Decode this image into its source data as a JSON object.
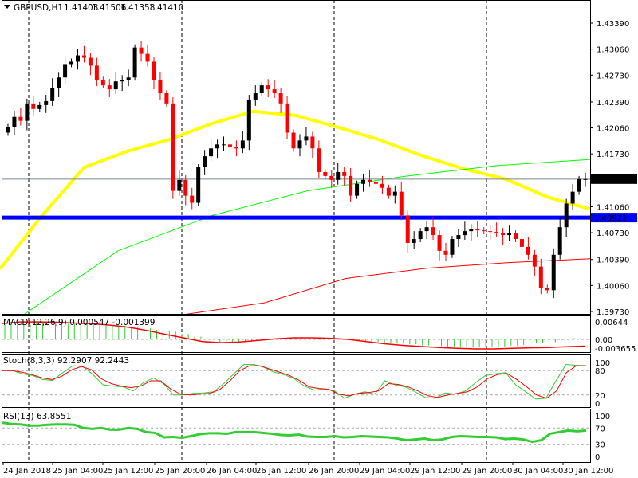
{
  "header": {
    "symbol": "GBPUSD,H1",
    "open": "1.41403",
    "high": "1.41506",
    "low": "1.41358",
    "close": "1.41410"
  },
  "colors": {
    "bull": "#000000",
    "bear": "#ff0000",
    "ma_fast": "#ffff00",
    "ma_mid": "#00ff00",
    "ma_slow": "#ff0000",
    "level": "#0000ff",
    "osc_k": "#32cd32",
    "osc_d": "#ff0000"
  },
  "chart_data": [
    {
      "type": "candlestick",
      "title": "GBPUSD,H1",
      "ylim": [
        1.3973,
        1.4339
      ],
      "y_ticks": [
        "1.43390",
        "1.43060",
        "1.42730",
        "1.42390",
        "1.42060",
        "1.41730",
        "1.41410",
        "1.41060",
        "1.40922",
        "1.40730",
        "1.40390",
        "1.40060",
        "1.39730"
      ],
      "current_price_label": "1.41410",
      "level_line": {
        "value": 1.40922,
        "label": "1.40922"
      },
      "x_tick_labels": [
        "24 Jan 2018",
        "25 Jan 04:00",
        "25 Jan 12:00",
        "25 Jan 20:00",
        "26 Jan 04:00",
        "26 Jan 12:00",
        "26 Jan 20:00",
        "29 Jan 04:00",
        "29 Jan 12:00",
        "29 Jan 20:00",
        "30 Jan 04:00",
        "30 Jan 12:00"
      ],
      "closes": [
        1.4207,
        1.422,
        1.4215,
        1.4237,
        1.423,
        1.4235,
        1.424,
        1.4257,
        1.427,
        1.4287,
        1.429,
        1.4298,
        1.4295,
        1.4285,
        1.4267,
        1.426,
        1.4255,
        1.4265,
        1.4267,
        1.427,
        1.4308,
        1.43,
        1.429,
        1.4267,
        1.425,
        1.4237,
        1.4126,
        1.414,
        1.412,
        1.4111,
        1.4156,
        1.417,
        1.418,
        1.4185,
        1.4185,
        1.4182,
        1.418,
        1.419,
        1.4242,
        1.425,
        1.426,
        1.4255,
        1.425,
        1.4237,
        1.42,
        1.418,
        1.419,
        1.4195,
        1.418,
        1.415,
        1.4145,
        1.414,
        1.415,
        1.4145,
        1.412,
        1.4135,
        1.414,
        1.4137,
        1.4135,
        1.413,
        1.412,
        1.4125,
        1.4095,
        1.406,
        1.4065,
        1.4075,
        1.408,
        1.407,
        1.405,
        1.4045,
        1.4065,
        1.407,
        1.4075,
        1.4078,
        1.4076,
        1.4075,
        1.4074,
        1.4073,
        1.407,
        1.4072,
        1.4065,
        1.4055,
        1.4045,
        1.403,
        1.4003,
        1.4,
        1.4045,
        1.408,
        1.411,
        1.4125,
        1.4141,
        1.4141
      ],
      "first_open": 1.42,
      "moving_averages": [
        {
          "name": "yellow MA",
          "start": 0.0,
          "values": [
            1.4027,
            1.4095,
            1.4156,
            1.4176,
            1.4191,
            1.4211,
            1.4227,
            1.4222,
            1.4207,
            1.4191,
            1.4171,
            1.4154,
            1.4141,
            1.4118,
            1.4103
          ]
        },
        {
          "name": "green MA",
          "start": 0.04,
          "values": [
            1.3969,
            1.405,
            1.4095,
            1.4126,
            1.4144,
            1.4158,
            1.4166
          ]
        },
        {
          "name": "red MA",
          "start": 0.31,
          "values": [
            1.3969,
            1.3984,
            1.4015,
            1.4028,
            1.4035,
            1.404
          ]
        }
      ]
    },
    {
      "type": "bar",
      "title": "MACD(12,26,9) 0.000547 -0.001399",
      "ylim": [
        -0.003655,
        0.00644
      ],
      "y_ticks": [
        "0.00644",
        "0.00",
        "-0.003655"
      ],
      "histogram": [
        0.0055,
        0.0056,
        0.0057,
        0.0058,
        0.0058,
        0.0057,
        0.0056,
        0.0055,
        0.0053,
        0.005,
        0.0045,
        0.004,
        0.0035,
        0.003,
        0.002,
        0.001,
        0.0002,
        -0.001,
        -0.0012,
        -0.0008,
        -0.0004,
        -0.0002,
        0.0002,
        0.0005,
        0.0007,
        0.0006,
        0.0004,
        0.0001,
        -0.0006,
        -0.001,
        -0.0014,
        -0.0016,
        -0.0018,
        -0.0022,
        -0.0025,
        -0.0028,
        -0.003,
        -0.003,
        -0.0028,
        -0.0026,
        -0.0024,
        -0.002,
        -0.0015,
        -0.001,
        -0.0002,
        0.0005
      ],
      "signal": [
        0.0058,
        0.0064,
        0.0064,
        0.0063,
        0.006,
        0.0057,
        0.0052,
        0.0044,
        0.0032,
        0.0018,
        0.0005,
        -0.0008,
        -0.0012,
        -0.001,
        -0.0004,
        0.0002,
        0.0006,
        0.0006,
        0.0004,
        0.0,
        -0.0008,
        -0.0016,
        -0.0022,
        -0.0026,
        -0.003,
        -0.0033,
        -0.0035,
        -0.0035,
        -0.0033,
        -0.0031,
        -0.003,
        -0.0027,
        -0.0025
      ]
    },
    {
      "type": "line",
      "title": "Stoch(8,3,3) 92.2907 92.2443",
      "ylim": [
        0,
        100
      ],
      "y_ticks": [
        "100",
        "80",
        "20",
        "0"
      ],
      "series": [
        {
          "name": "%K",
          "values": [
            80,
            80,
            72,
            68,
            58,
            56,
            75,
            92,
            90,
            70,
            45,
            42,
            40,
            30,
            50,
            62,
            48,
            20,
            20,
            24,
            25,
            28,
            48,
            72,
            95,
            95,
            88,
            76,
            70,
            60,
            42,
            32,
            35,
            30,
            12,
            22,
            28,
            22,
            55,
            45,
            40,
            28,
            14,
            12,
            25,
            22,
            30,
            50,
            68,
            72,
            75,
            45,
            28,
            10,
            12,
            55,
            95,
            93,
            92
          ]
        },
        {
          "name": "%D",
          "values": [
            80,
            80,
            76,
            70,
            62,
            58,
            66,
            82,
            90,
            82,
            60,
            48,
            42,
            38,
            42,
            55,
            55,
            35,
            22,
            20,
            22,
            24,
            34,
            55,
            80,
            92,
            92,
            84,
            76,
            68,
            56,
            40,
            36,
            34,
            22,
            18,
            24,
            26,
            30,
            48,
            46,
            40,
            30,
            18,
            14,
            20,
            24,
            28,
            40,
            60,
            70,
            73,
            58,
            40,
            20,
            12,
            30,
            75,
            92,
            92
          ]
        }
      ]
    },
    {
      "type": "line",
      "title": "RSI(13) 63.8551",
      "ylim": [
        0,
        100
      ],
      "y_ticks": [
        "100",
        "70",
        "30",
        "0"
      ],
      "series": [
        {
          "name": "RSI",
          "values": [
            83,
            80,
            79,
            76,
            76,
            78,
            79,
            79,
            78,
            70,
            68,
            70,
            66,
            66,
            70,
            68,
            60,
            58,
            47,
            48,
            46,
            50,
            55,
            57,
            57,
            56,
            60,
            60,
            60,
            58,
            56,
            53,
            52,
            54,
            49,
            48,
            48,
            50,
            47,
            48,
            50,
            49,
            48,
            47,
            44,
            40,
            42,
            44,
            40,
            42,
            48,
            50,
            49,
            48,
            48,
            47,
            43,
            44,
            42,
            36,
            40,
            56,
            60,
            64,
            62,
            64
          ]
        }
      ]
    }
  ]
}
